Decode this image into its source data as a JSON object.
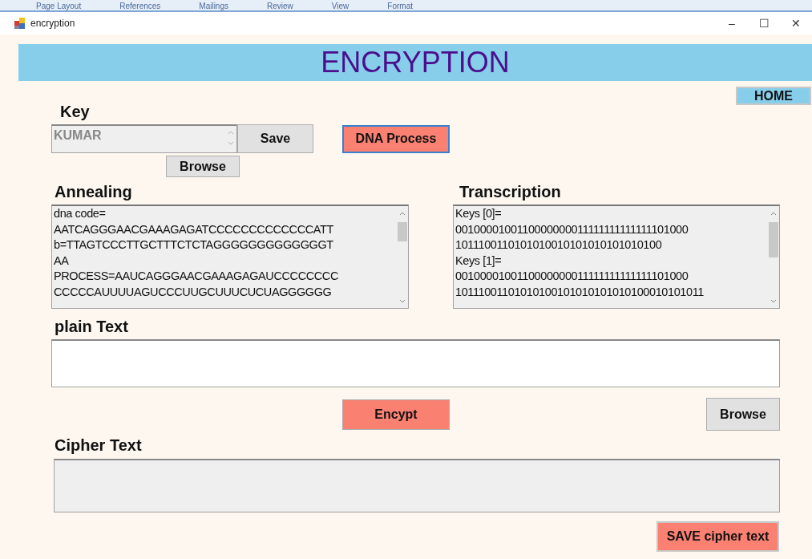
{
  "background_ribbon": {
    "tabs": [
      "Page Layout",
      "References",
      "Mailings",
      "Review",
      "View",
      "Format"
    ]
  },
  "window": {
    "title": "encryption",
    "controls": [
      "–",
      "☐",
      "✕"
    ]
  },
  "header": {
    "title": "ENCRYPTION"
  },
  "home_button": "HOME",
  "key": {
    "label": "Key",
    "value": "KUMAR",
    "disabled": true,
    "save_button": "Save",
    "browse_button": "Browse"
  },
  "dna_process_button": {
    "label": "DNA Process",
    "focused": true
  },
  "annealing": {
    "label": "Annealing",
    "lines": [
      "dna code=",
      "AATCAGGGAACGAAAGAGATCCCCCCCCCCCCCATT",
      "b=TTAGTCCCTTGCTTTCTCTAGGGGGGGGGGGGGT",
      "AA",
      "PROCESS=AAUCAGGGAACGAAAGAGAUCCCCCCCC",
      "CCCCCAUUUUAGUCCCUUGCUUUCUCUAGGGGGG"
    ]
  },
  "transcription": {
    "label": "Transcription",
    "lines": [
      "Keys [0]=",
      "0010000100110000000011111111111111101000",
      "1011100110101010010101010101010100",
      "Keys [1]=",
      "0010000100110000000011111111111111101000",
      "10111001101010100101010101010100010101011"
    ]
  },
  "plain_text": {
    "label": "plain Text"
  },
  "encrypt_button": "Encypt",
  "browse_button": "Browse",
  "cipher_text": {
    "label": "Cipher Text",
    "disabled": true
  },
  "save_cipher_button": "SAVE cipher text"
}
